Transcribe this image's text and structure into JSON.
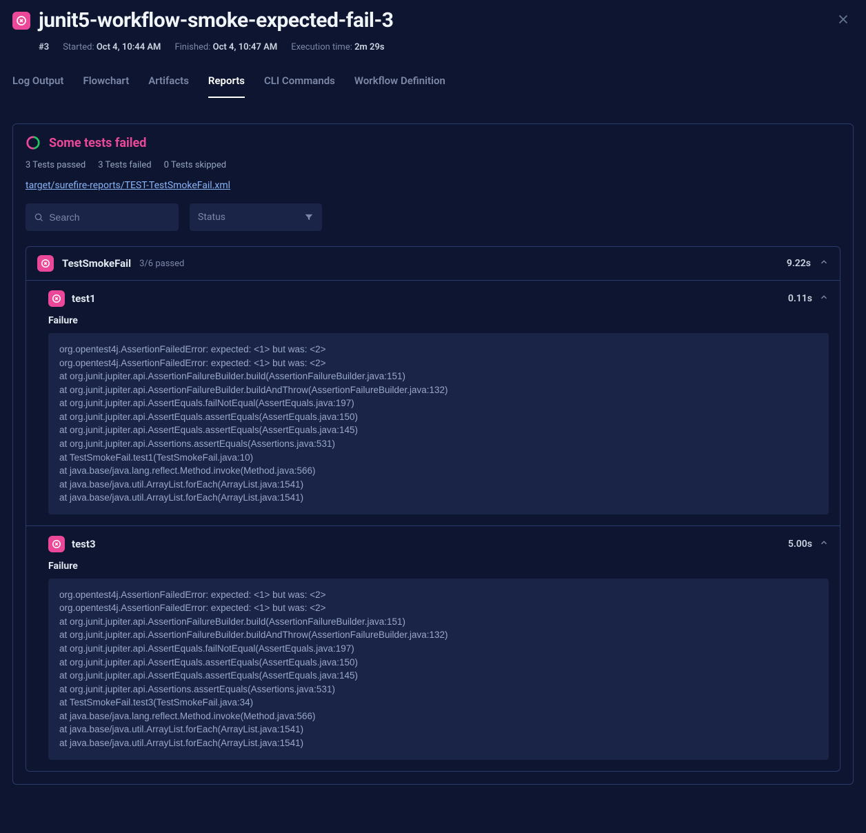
{
  "header": {
    "title": "junit5-workflow-smoke-expected-fail-3"
  },
  "meta": {
    "run_number": "#3",
    "started_label": "Started:",
    "started_value": "Oct 4, 10:44 AM",
    "finished_label": "Finished:",
    "finished_value": "Oct 4, 10:47 AM",
    "exec_label": "Execution time:",
    "exec_value": "2m 29s"
  },
  "tabs": [
    "Log Output",
    "Flowchart",
    "Artifacts",
    "Reports",
    "CLI Commands",
    "Workflow Definition"
  ],
  "active_tab": "Reports",
  "report": {
    "title": "Some tests failed",
    "stats": {
      "passed": "3 Tests passed",
      "failed": "3 Tests failed",
      "skipped": "0 Tests skipped"
    },
    "file": "target/surefire-reports/TEST-TestSmokeFail.xml",
    "search_placeholder": "Search",
    "status_label": "Status"
  },
  "suite": {
    "name": "TestSmokeFail",
    "summary": "3/6 passed",
    "time": "9.22s",
    "tests": [
      {
        "name": "test1",
        "time": "0.11s",
        "label": "Failure",
        "trace": "org.opentest4j.AssertionFailedError: expected: <1> but was: <2>\norg.opentest4j.AssertionFailedError: expected: <1> but was: <2>\nat org.junit.jupiter.api.AssertionFailureBuilder.build(AssertionFailureBuilder.java:151)\nat org.junit.jupiter.api.AssertionFailureBuilder.buildAndThrow(AssertionFailureBuilder.java:132)\nat org.junit.jupiter.api.AssertEquals.failNotEqual(AssertEquals.java:197)\nat org.junit.jupiter.api.AssertEquals.assertEquals(AssertEquals.java:150)\nat org.junit.jupiter.api.AssertEquals.assertEquals(AssertEquals.java:145)\nat org.junit.jupiter.api.Assertions.assertEquals(Assertions.java:531)\nat TestSmokeFail.test1(TestSmokeFail.java:10)\nat java.base/java.lang.reflect.Method.invoke(Method.java:566)\nat java.base/java.util.ArrayList.forEach(ArrayList.java:1541)\nat java.base/java.util.ArrayList.forEach(ArrayList.java:1541)"
      },
      {
        "name": "test3",
        "time": "5.00s",
        "label": "Failure",
        "trace": "org.opentest4j.AssertionFailedError: expected: <1> but was: <2>\norg.opentest4j.AssertionFailedError: expected: <1> but was: <2>\nat org.junit.jupiter.api.AssertionFailureBuilder.build(AssertionFailureBuilder.java:151)\nat org.junit.jupiter.api.AssertionFailureBuilder.buildAndThrow(AssertionFailureBuilder.java:132)\nat org.junit.jupiter.api.AssertEquals.failNotEqual(AssertEquals.java:197)\nat org.junit.jupiter.api.AssertEquals.assertEquals(AssertEquals.java:150)\nat org.junit.jupiter.api.AssertEquals.assertEquals(AssertEquals.java:145)\nat org.junit.jupiter.api.Assertions.assertEquals(Assertions.java:531)\nat TestSmokeFail.test3(TestSmokeFail.java:34)\nat java.base/java.lang.reflect.Method.invoke(Method.java:566)\nat java.base/java.util.ArrayList.forEach(ArrayList.java:1541)\nat java.base/java.util.ArrayList.forEach(ArrayList.java:1541)"
      }
    ]
  }
}
